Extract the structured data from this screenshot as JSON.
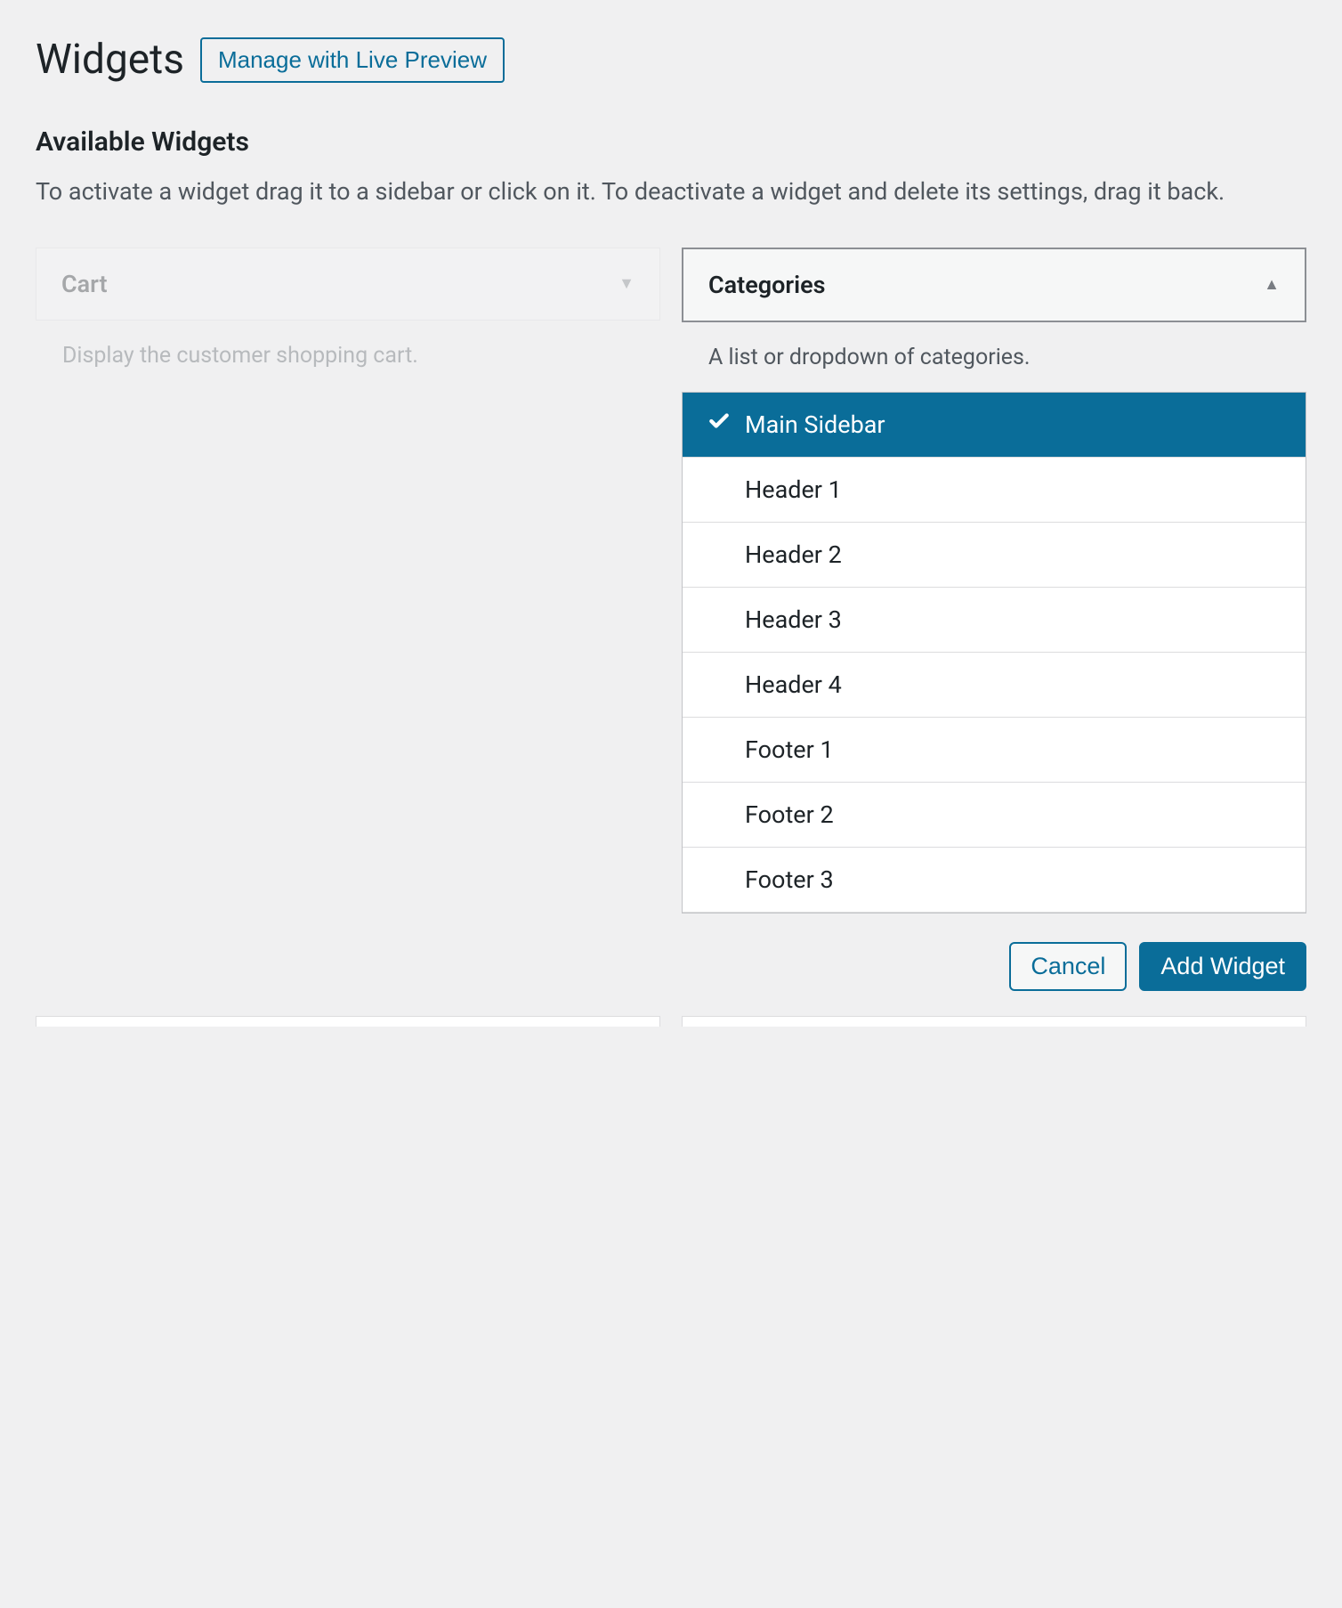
{
  "header": {
    "title": "Widgets",
    "live_preview_label": "Manage with Live Preview"
  },
  "section": {
    "title": "Available Widgets",
    "description": "To activate a widget drag it to a sidebar or click on it. To deactivate a widget and delete its settings, drag it back."
  },
  "widgets": {
    "left": {
      "name": "Cart",
      "description": "Display the customer shopping cart."
    },
    "right": {
      "name": "Categories",
      "description": "A list or dropdown of categories."
    }
  },
  "chooser": {
    "areas": [
      {
        "label": "Main Sidebar",
        "selected": true
      },
      {
        "label": "Header 1",
        "selected": false
      },
      {
        "label": "Header 2",
        "selected": false
      },
      {
        "label": "Header 3",
        "selected": false
      },
      {
        "label": "Header 4",
        "selected": false
      },
      {
        "label": "Footer 1",
        "selected": false
      },
      {
        "label": "Footer 2",
        "selected": false
      },
      {
        "label": "Footer 3",
        "selected": false
      }
    ],
    "cancel_label": "Cancel",
    "add_label": "Add Widget"
  }
}
